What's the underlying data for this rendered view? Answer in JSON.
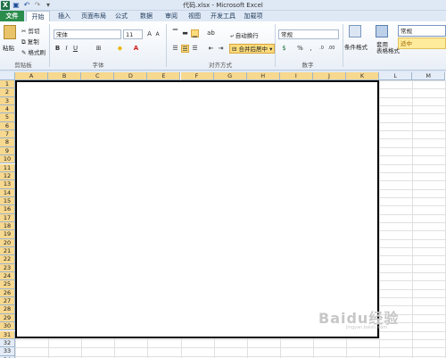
{
  "window": {
    "title": "代码.xlsx - Microsoft Excel"
  },
  "tabs": [
    "文件",
    "开始",
    "插入",
    "页面布局",
    "公式",
    "数据",
    "审阅",
    "视图",
    "开发工具",
    "加载项"
  ],
  "clipboard": {
    "paste": "粘贴",
    "cut": "剪切",
    "copy": "复制",
    "format_painter": "格式刷",
    "group": "剪贴板"
  },
  "font": {
    "name": "宋体",
    "size": "11",
    "bold": "B",
    "italic": "I",
    "underline": "U",
    "group": "字体"
  },
  "alignment": {
    "wrap": "自动换行",
    "merge": "合并后居中",
    "group": "对齐方式"
  },
  "number": {
    "format": "常规",
    "percent": "%",
    "comma": ",",
    "group": "数字"
  },
  "styles": {
    "conditional": "条件格式",
    "table": "套用\n表格格式",
    "normal": "常规",
    "neutral": "适中"
  },
  "columns_selected": [
    "A",
    "B",
    "C",
    "D",
    "E",
    "F",
    "G",
    "H",
    "I",
    "J",
    "K"
  ],
  "columns_other": [
    "L",
    "M"
  ],
  "rows": [
    "1",
    "2",
    "3",
    "4",
    "5",
    "6",
    "7",
    "8",
    "9",
    "10",
    "11",
    "12",
    "13",
    "14",
    "15",
    "16",
    "17",
    "18",
    "19",
    "20",
    "21",
    "22",
    "23",
    "24",
    "25",
    "26",
    "27",
    "28",
    "29",
    "30",
    "31",
    "32",
    "33",
    "34"
  ],
  "watermark": {
    "text": "Baidu经验",
    "sub": "jingyan.baidu.com"
  },
  "colors": {
    "selected_header": "#f7d88f",
    "file_tab": "#2a8d4b",
    "neutral_style": "#ffeb9c"
  }
}
